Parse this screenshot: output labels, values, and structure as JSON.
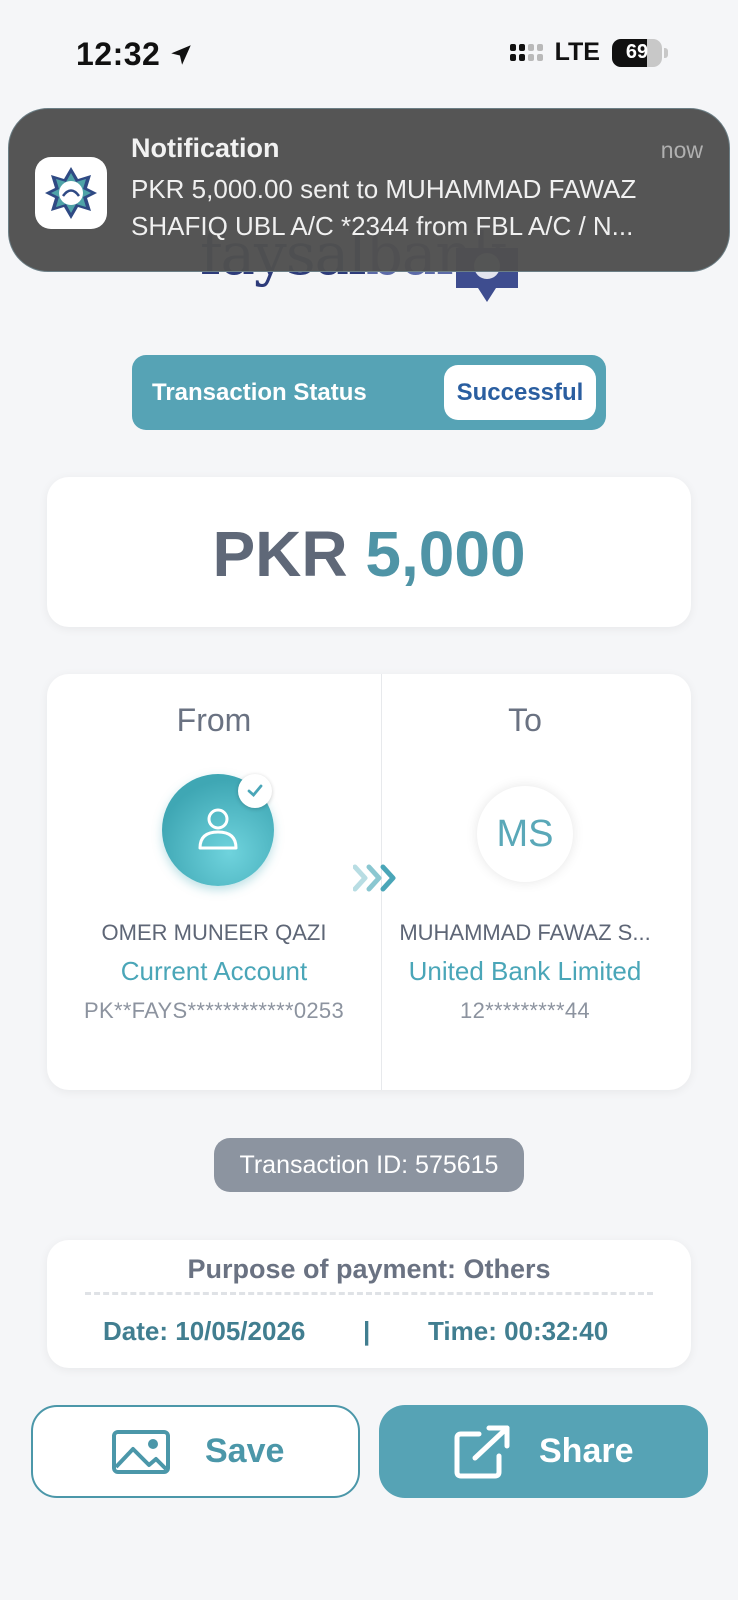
{
  "status_bar": {
    "time": "12:32",
    "network": "LTE",
    "battery": "69",
    "battery_level": 0.69
  },
  "notification": {
    "title": "Notification",
    "time": "now",
    "body_line1": "PKR 5,000.00 sent to MUHAMMAD FAWAZ",
    "body_line2": "SHAFIQ UBL A/C *2344 from FBL A/C / N..."
  },
  "logo": {
    "text_part1": "faysal",
    "text_part2": "bank"
  },
  "transaction_status": {
    "label": "Transaction Status",
    "value": "Successful"
  },
  "amount": {
    "currency": "PKR",
    "value": "5,000"
  },
  "from": {
    "heading": "From",
    "name": "OMER MUNEER QAZI",
    "account_type": "Current Account",
    "account_number": "PK**FAYS************0253"
  },
  "to": {
    "heading": "To",
    "initials": "MS",
    "name": "MUHAMMAD FAWAZ S...",
    "bank": "United Bank Limited",
    "account_number": "12*********44"
  },
  "transaction_id": "Transaction ID: 575615",
  "details": {
    "purpose": "Purpose of payment: Others",
    "date": "Date: 10/05/2026",
    "separator": "|",
    "time": "Time: 00:32:40"
  },
  "actions": {
    "save_label": "Save",
    "share_label": "Share"
  },
  "colors": {
    "primary": "#56a3b5",
    "accent_text": "#4aa6b8",
    "status_badge_text": "#2a5ea0",
    "notification_bg": "#505050"
  }
}
